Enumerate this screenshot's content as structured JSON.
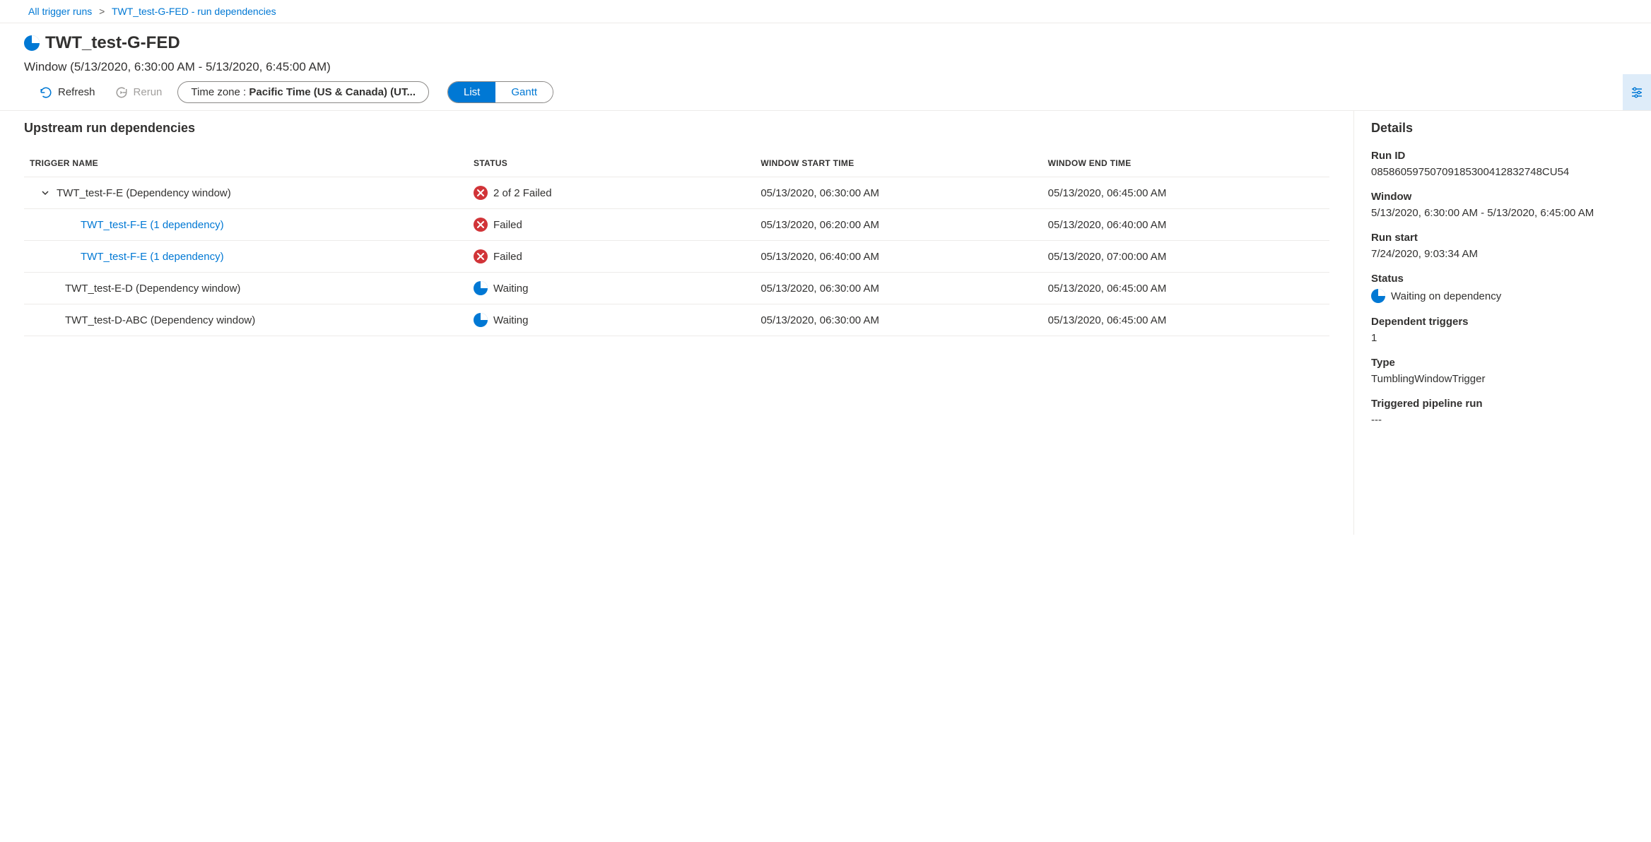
{
  "breadcrumb": {
    "root": "All trigger runs",
    "current": "TWT_test-G-FED - run dependencies"
  },
  "header": {
    "title": "TWT_test-G-FED",
    "window_text": "Window (5/13/2020, 6:30:00 AM - 5/13/2020, 6:45:00 AM)"
  },
  "toolbar": {
    "refresh": "Refresh",
    "rerun": "Rerun",
    "timezone_label": "Time zone : ",
    "timezone_value": "Pacific Time (US & Canada) (UT...",
    "view_list": "List",
    "view_gantt": "Gantt"
  },
  "section_title": "Upstream run dependencies",
  "columns": {
    "trigger": "TRIGGER NAME",
    "status": "STATUS",
    "start": "WINDOW START TIME",
    "end": "WINDOW END TIME"
  },
  "rows": [
    {
      "indent": 0,
      "expandable": true,
      "name": "TWT_test-F-E (Dependency window)",
      "link": false,
      "statusIcon": "fail",
      "statusText": "2 of 2 Failed",
      "start": "05/13/2020, 06:30:00 AM",
      "end": "05/13/2020, 06:45:00 AM"
    },
    {
      "indent": 1,
      "expandable": false,
      "name": "TWT_test-F-E (1 dependency)",
      "link": true,
      "statusIcon": "fail",
      "statusText": "Failed",
      "start": "05/13/2020, 06:20:00 AM",
      "end": "05/13/2020, 06:40:00 AM"
    },
    {
      "indent": 1,
      "expandable": false,
      "name": "TWT_test-F-E (1 dependency)",
      "link": true,
      "statusIcon": "fail",
      "statusText": "Failed",
      "start": "05/13/2020, 06:40:00 AM",
      "end": "05/13/2020, 07:00:00 AM"
    },
    {
      "indent": 0,
      "expandable": false,
      "name": "TWT_test-E-D (Dependency window)",
      "link": false,
      "statusIcon": "waiting",
      "statusText": "Waiting",
      "start": "05/13/2020, 06:30:00 AM",
      "end": "05/13/2020, 06:45:00 AM"
    },
    {
      "indent": 0,
      "expandable": false,
      "name": "TWT_test-D-ABC (Dependency window)",
      "link": false,
      "statusIcon": "waiting",
      "statusText": "Waiting",
      "start": "05/13/2020, 06:30:00 AM",
      "end": "05/13/2020, 06:45:00 AM"
    }
  ],
  "details": {
    "title": "Details",
    "run_id_label": "Run ID",
    "run_id": "08586059750709185300412832748CU54",
    "window_label": "Window",
    "window": "5/13/2020, 6:30:00 AM - 5/13/2020, 6:45:00 AM",
    "run_start_label": "Run start",
    "run_start": "7/24/2020, 9:03:34 AM",
    "status_label": "Status",
    "status": "Waiting on dependency",
    "dep_triggers_label": "Dependent triggers",
    "dep_triggers": "1",
    "type_label": "Type",
    "type": "TumblingWindowTrigger",
    "pipeline_label": "Triggered pipeline run",
    "pipeline": "---"
  }
}
